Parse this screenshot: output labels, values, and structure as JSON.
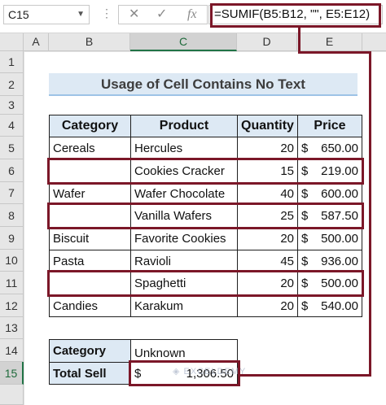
{
  "formula_bar": {
    "name_box": "C15",
    "icons": [
      "x-icon",
      "check-icon",
      "fx-icon"
    ],
    "formula": "=SUMIF(B5:B12, \"\", E5:E12)"
  },
  "columns": [
    "A",
    "B",
    "C",
    "D",
    "E"
  ],
  "active_column": "C",
  "active_row": "15",
  "rows": [
    "1",
    "2",
    "3",
    "4",
    "5",
    "6",
    "7",
    "8",
    "9",
    "10",
    "11",
    "12",
    "13",
    "14",
    "15"
  ],
  "title": "Usage of Cell Contains No Text",
  "table": {
    "headers": [
      "Category",
      "Product",
      "Quantity",
      "Price"
    ],
    "currency_symbol": "$",
    "rows": [
      {
        "category": "Cereals",
        "product": "Hercules",
        "quantity": "20",
        "price": "650.00"
      },
      {
        "category": "",
        "product": "Cookies Cracker",
        "quantity": "15",
        "price": "219.00"
      },
      {
        "category": "Wafer",
        "product": "Wafer Chocolate",
        "quantity": "40",
        "price": "600.00"
      },
      {
        "category": "",
        "product": "Vanilla Wafers",
        "quantity": "25",
        "price": "587.50"
      },
      {
        "category": "Biscuit",
        "product": "Favorite Cookies",
        "quantity": "20",
        "price": "500.00"
      },
      {
        "category": "Pasta",
        "product": "Ravioli",
        "quantity": "45",
        "price": "936.00"
      },
      {
        "category": "",
        "product": "Spaghetti",
        "quantity": "20",
        "price": "500.00"
      },
      {
        "category": "Candies",
        "product": "Karakum",
        "quantity": "20",
        "price": "540.00"
      }
    ]
  },
  "summary": {
    "category_label": "Category",
    "category_value": "Unknown",
    "total_label": "Total Sell",
    "total_currency": "$",
    "total_value": "1,306.50"
  },
  "colors": {
    "highlight": "#7b1728",
    "header_fill": "#dde9f4",
    "excel_green": "#217346"
  }
}
